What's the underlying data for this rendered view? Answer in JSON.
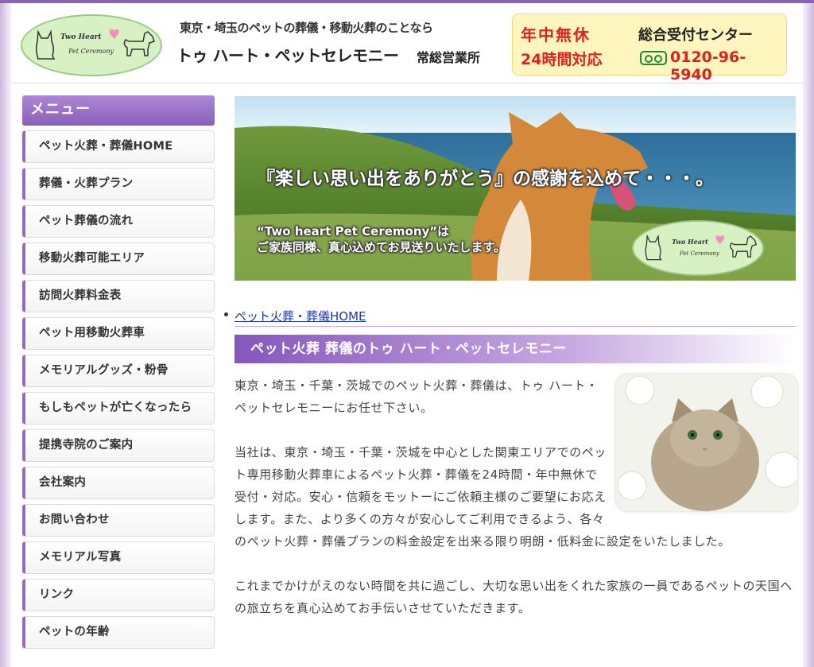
{
  "header": {
    "logo_line1": "Two Heart",
    "logo_line2": "Pet Ceremony",
    "tagline": "東京・埼玉のペットの葬儀・移動火葬のことなら",
    "brand": "トゥ ハート・ペットセレモニー",
    "office": "常総営業所",
    "contact": {
      "open_label": "年中無休",
      "hours_label": "24時間対応",
      "center_label": "総合受付センター",
      "freedial_icon": "freedial-icon",
      "phone": "0120-96-5940"
    }
  },
  "sidebar": {
    "title": "メニュー",
    "items": [
      {
        "label": "ペット火葬・葬儀HOME"
      },
      {
        "label": "葬儀・火葬プラン"
      },
      {
        "label": "ペット葬儀の流れ"
      },
      {
        "label": "移動火葬可能エリア"
      },
      {
        "label": "訪問火葬料金表"
      },
      {
        "label": "ペット用移動火葬車"
      },
      {
        "label": "メモリアルグッズ・粉骨"
      },
      {
        "label": "もしもペットが亡くなったら"
      },
      {
        "label": "提携寺院のご案内"
      },
      {
        "label": "会社案内"
      },
      {
        "label": "お問い合わせ"
      },
      {
        "label": "メモリアル写真"
      },
      {
        "label": "リンク"
      },
      {
        "label": "ペットの年齢"
      }
    ]
  },
  "hero": {
    "caption": "『楽しい思い出をありがとう』の感謝を込めて・・・。",
    "sub_line1": "“Two heart Pet Ceremony”は",
    "sub_line2": "ご家族同様、真心込めてお見送りいたします。",
    "logo_line1": "Two Heart",
    "logo_line2": "Pet Ceremony"
  },
  "main": {
    "breadcrumb": "ペット火葬・葬儀HOME",
    "section_title": "ペット火葬 葬儀のトゥ ハート・ペットセレモニー",
    "paragraphs": [
      "東京・埼玉・千葉・茨城でのペット火葬・葬儀は、トゥ ハート・ペットセレモニーにお任せ下さい。",
      "当社は、東京・埼玉・千葉・茨城を中心とした関東エリアでのペット専用移動火葬車によるペット火葬・葬儀を24時間・年中無休で受付・対応。安心・信頼をモットーにご依頼主様のご要望にお応えします。また、より多くの方々が安心してご利用できるよう、各々のペット火葬・葬儀プランの料金設定を出来る限り明朗・低料金に設定をいたしました。",
      "これまでかけがえのない時間を共に過ごし、大切な思い出をくれた家族の一員であるペットの天国への旅立ちを真心込めてお手伝いさせていただきます。"
    ]
  },
  "colors": {
    "accent": "#8d62b7",
    "contact_red": "#e0201a",
    "contact_bg": "#fff6bf",
    "link": "#1a37a8"
  }
}
